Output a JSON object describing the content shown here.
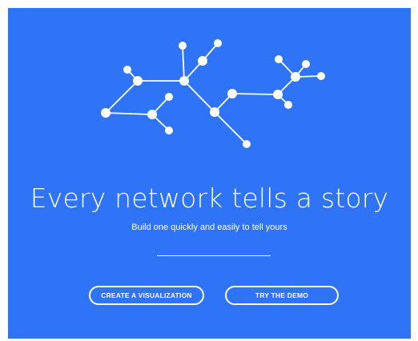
{
  "hero": {
    "headline": "Every network tells a story",
    "tagline": "Build one quickly and easily to tell yours",
    "background_color": "#2f74f7",
    "foreground_color": "#ffffff"
  },
  "actions": {
    "create_label": "CREATE A VISUALIZATION",
    "demo_label": "TRY THE DEMO"
  },
  "illustration": {
    "icon": "network-graph-icon"
  }
}
